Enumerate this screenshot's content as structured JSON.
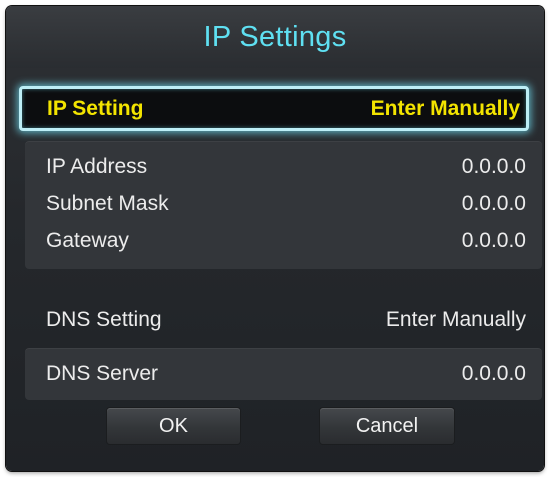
{
  "dialog": {
    "title": "IP Settings"
  },
  "ip_setting": {
    "label": "IP Setting",
    "value": "Enter Manually"
  },
  "ip_fields": [
    {
      "label": "IP Address",
      "value": "0.0.0.0"
    },
    {
      "label": "Subnet Mask",
      "value": "0.0.0.0"
    },
    {
      "label": "Gateway",
      "value": "0.0.0.0"
    }
  ],
  "dns_setting": {
    "label": "DNS Setting",
    "value": "Enter Manually"
  },
  "dns_server": {
    "label": "DNS Server",
    "value": "0.0.0.0"
  },
  "buttons": {
    "ok": "OK",
    "cancel": "Cancel"
  },
  "colors": {
    "title": "#5fe0f2",
    "focus_text": "#f3e400",
    "focus_border": "#bdeef6",
    "text": "#ececec",
    "dialog_bg": "#26292d"
  }
}
